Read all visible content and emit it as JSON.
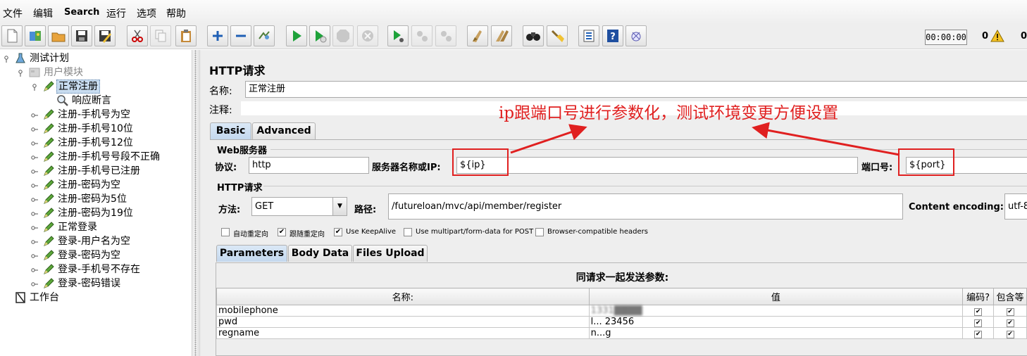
{
  "menu": [
    "文件",
    "编辑",
    "Search",
    "运行",
    "选项",
    "帮助"
  ],
  "toolbar": {
    "icons": [
      "new-icon",
      "templates-icon",
      "open-icon",
      "save-icon",
      "save-as-icon",
      "cut-icon",
      "copy-icon",
      "paste-icon",
      "expand-icon",
      "collapse-icon",
      "toggle-icon",
      "start-icon",
      "start-no-pause-icon",
      "stop-icon",
      "shutdown-icon",
      "remote-start-icon",
      "remote-stop-icon",
      "remote-shutdown-icon",
      "clear-icon",
      "clear-all-icon",
      "search-icon",
      "reset-search-icon",
      "function-helper-icon",
      "help-icon",
      "log-viewer-icon"
    ],
    "timer": "00:00:00",
    "warnings": "0",
    "errors": "0"
  },
  "tree": {
    "plan": "测试计划",
    "group": "用户模块",
    "items": [
      "正常注册",
      "响应断言",
      "注册-手机号为空",
      "注册-手机号10位",
      "注册-手机号12位",
      "注册-手机号号段不正确",
      "注册-手机号已注册",
      "注册-密码为空",
      "注册-密码为5位",
      "注册-密码为19位",
      "正常登录",
      "登录-用户名为空",
      "登录-密码为空",
      "登录-手机号不存在",
      "登录-密码错误"
    ],
    "workbench": "工作台"
  },
  "panel": {
    "title": "HTTP请求",
    "name_label": "名称:",
    "name_value": "正常注册",
    "comment_label": "注释:",
    "tabs": [
      "Basic",
      "Advanced"
    ],
    "web_server_title": "Web服务器",
    "protocol_label": "协议:",
    "protocol_value": "http",
    "server_label": "服务器名称或IP:",
    "server_value": "${ip}",
    "port_label": "端口号:",
    "port_value": "${port}",
    "http_title": "HTTP请求",
    "method_label": "方法:",
    "method_value": "GET",
    "path_label": "路径:",
    "path_value": "/futureloan/mvc/api/member/register",
    "encoding_label": "Content encoding:",
    "encoding_value": "utf-8",
    "options": [
      {
        "label": "自动重定向",
        "checked": false
      },
      {
        "label": "跟随重定向",
        "checked": true
      },
      {
        "label": "Use KeepAlive",
        "checked": true
      },
      {
        "label": "Use multipart/form-data for POST",
        "checked": false
      },
      {
        "label": "Browser-compatible headers",
        "checked": false
      }
    ],
    "param_tabs": [
      "Parameters",
      "Body Data",
      "Files Upload"
    ],
    "params_title": "同请求一起发送参数:",
    "columns": [
      "名称:",
      "值",
      "编码?",
      "包含等"
    ],
    "rows": [
      {
        "name": "mobilephone",
        "value": "1331████",
        "encode": "✔",
        "include": "✔"
      },
      {
        "name": "pwd",
        "value": "l...  23456",
        "encode": "✔",
        "include": "✔"
      },
      {
        "name": "regname",
        "value": "n...g",
        "encode": "✔",
        "include": "✔"
      }
    ]
  },
  "annotation": "ip跟端口号进行参数化，测试环境变更方便设置",
  "colors": {
    "annotation": "#e02020",
    "selection": "#c8dcf0",
    "panel_bg": "#eeeeee"
  }
}
